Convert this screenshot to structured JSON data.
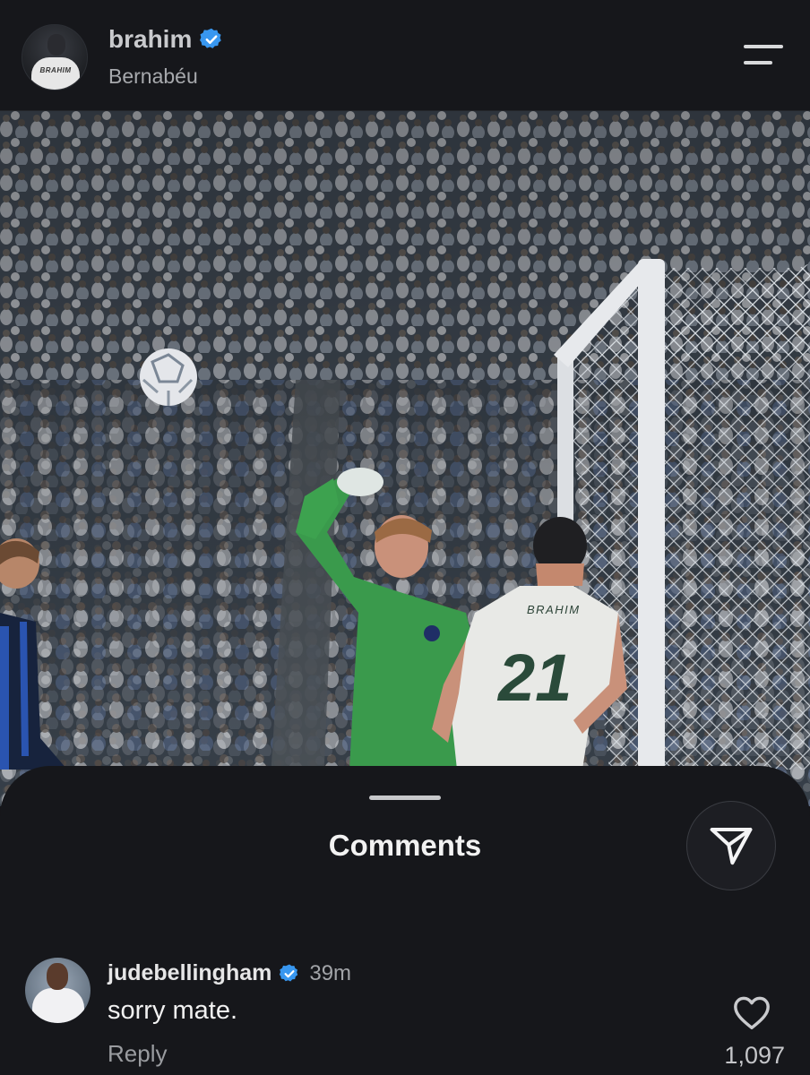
{
  "header": {
    "username": "brahim",
    "verified_icon": "verified-badge-icon",
    "location": "Bernabéu",
    "avatar_jersey_text": "BRAHIM",
    "menu_icon": "menu-icon"
  },
  "post": {
    "image_jersey_name": "BRAHIM",
    "image_jersey_number": "21"
  },
  "comments_sheet": {
    "title": "Comments",
    "share_icon": "send-icon",
    "comments": [
      {
        "username": "judebellingham",
        "verified": true,
        "time": "39m",
        "text": "sorry mate.",
        "reply_label": "Reply",
        "like_icon": "heart-icon",
        "likes": "1,097"
      }
    ]
  },
  "colors": {
    "background": "#16171b",
    "verified_blue": "#3897f0",
    "keeper_green": "#3a9a4c"
  }
}
